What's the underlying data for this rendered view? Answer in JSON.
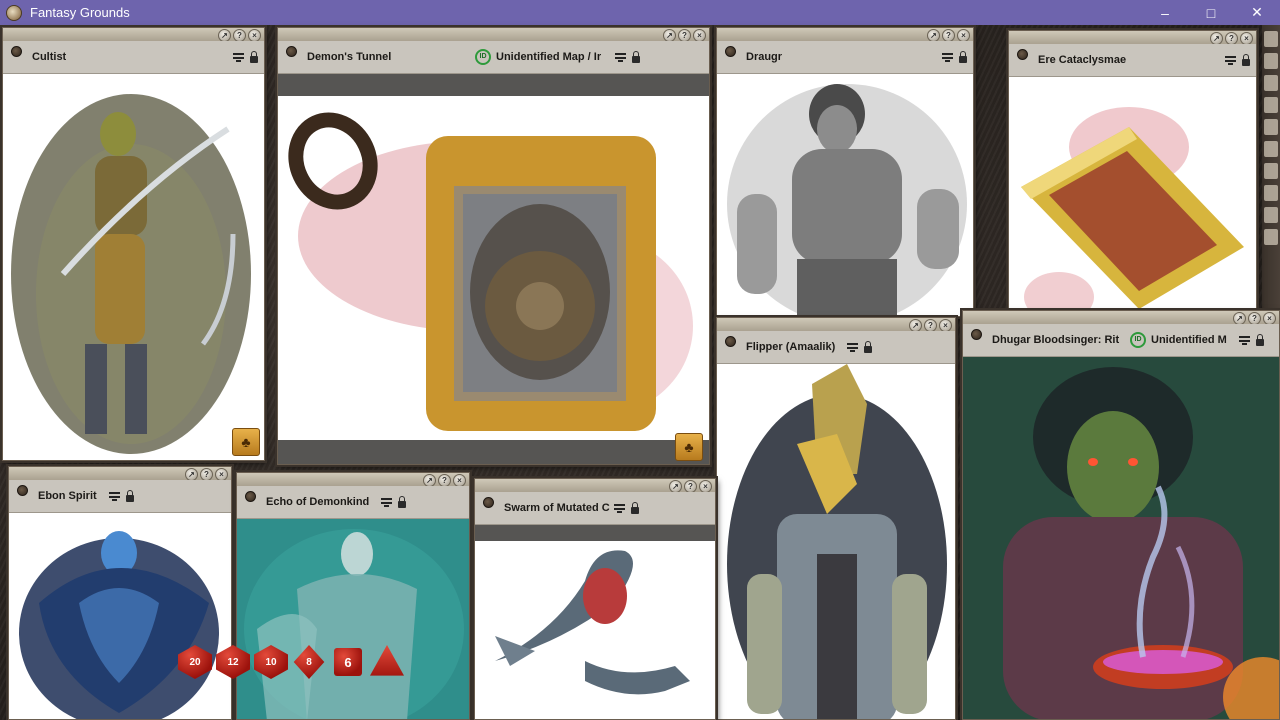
{
  "app": {
    "title": "Fantasy Grounds"
  },
  "windows": [
    {
      "id": "cultist",
      "name": "Cultist"
    },
    {
      "id": "tunnel",
      "name": "Demon's Tunnel",
      "subtitle": "Unidentified Map / Ir"
    },
    {
      "id": "draugr",
      "name": "Draugr"
    },
    {
      "id": "ere",
      "name": "Ere Cataclysmae"
    },
    {
      "id": "flipper",
      "name": "Flipper (Amaalik)"
    },
    {
      "id": "dhugar",
      "name": "Dhugar Bloodsinger: Rit",
      "subtitle": "Unidentified M"
    },
    {
      "id": "ebon",
      "name": "Ebon Spirit"
    },
    {
      "id": "echo",
      "name": "Echo of Demonkind"
    },
    {
      "id": "swarm",
      "name": "Swarm of Mutated C"
    }
  ],
  "dice": [
    "20",
    "12",
    "10",
    "8",
    "6",
    ""
  ],
  "colors": {
    "titlebar": "#6e64ad",
    "identified_green": "#2e9a3b",
    "die_red": "#c22218"
  }
}
